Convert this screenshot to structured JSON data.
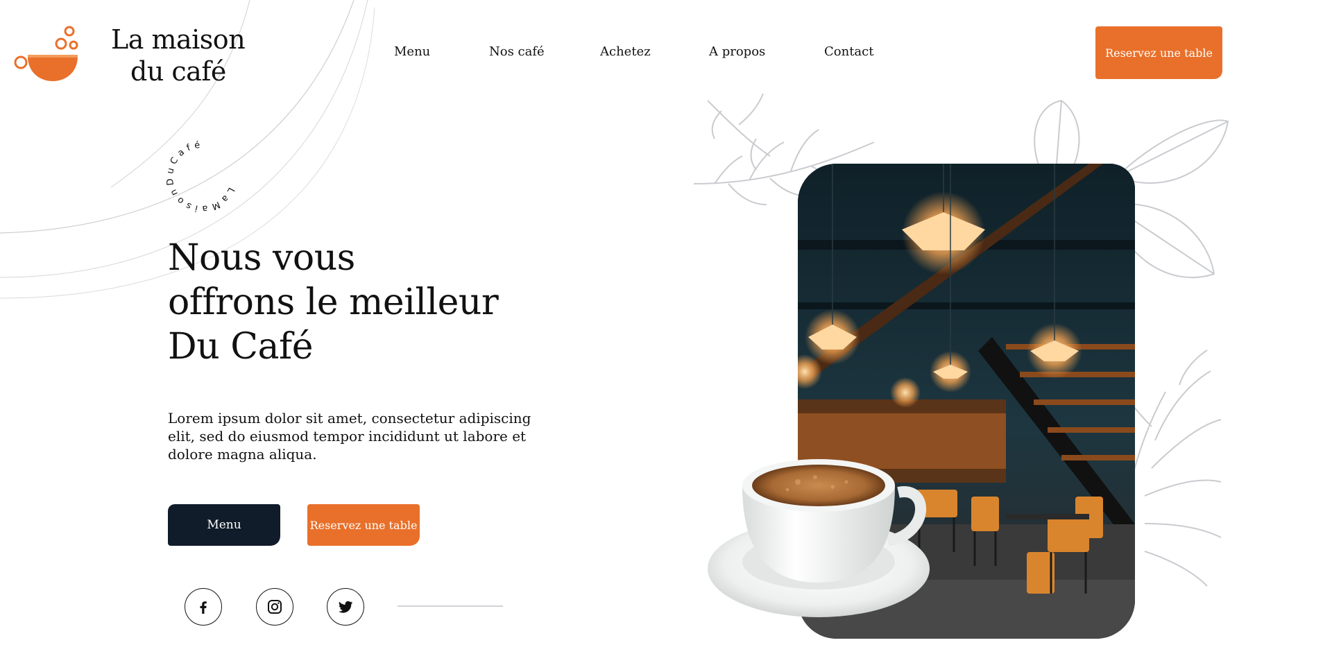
{
  "brand": {
    "name_line1": "La maison",
    "name_line2": "du café",
    "circular_text": "LaMaisonDuCafé",
    "accent_color": "#e9702a",
    "dark_color": "#111c2a"
  },
  "nav": {
    "items": [
      "Menu",
      "Nos café",
      "Achetez",
      "A propos",
      "Contact"
    ],
    "cta_label": "Reservez une table"
  },
  "hero": {
    "title_line1": "Nous vous",
    "title_line2": "offrons le meilleur",
    "title_line3": "Du Café",
    "text": "Lorem ipsum dolor sit amet, consectetur adipiscing elit, sed do eiusmod tempor incididunt ut labore et dolore magna aliqua.",
    "menu_button": "Menu",
    "reserve_button": "Reservez une table"
  },
  "social": {
    "icons": [
      "facebook-icon",
      "instagram-icon",
      "twitter-icon"
    ]
  }
}
